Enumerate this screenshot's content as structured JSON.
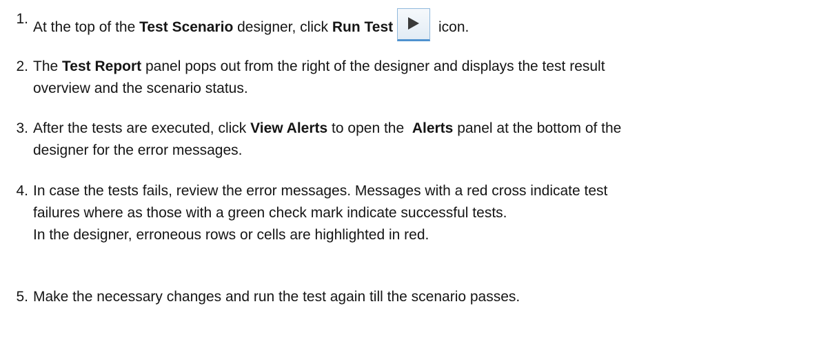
{
  "steps": [
    {
      "number": "1.",
      "parts": [
        "At the top of the ",
        "Test Scenario",
        " designer, click ",
        "Run Test",
        " icon."
      ],
      "icon": "play-icon"
    },
    {
      "number": "2.",
      "parts": [
        "The ",
        "Test Report",
        " panel pops out from the right of the designer and displays the test result"
      ],
      "line2": "overview and the scenario status."
    },
    {
      "number": "3.",
      "parts": [
        "After the tests are executed, click ",
        "View Alerts",
        " to open the  ",
        "Alerts",
        " panel at the bottom of the"
      ],
      "line2": "designer for the error messages."
    },
    {
      "number": "4.",
      "line1": "In case the tests fails, review the error messages. Messages with a red cross indicate test",
      "line2": "failures where as those with a green check mark indicate successful tests.",
      "line3": "In the designer, erroneous rows or cells are highlighted in red."
    },
    {
      "number": "5.",
      "line1": "Make the necessary changes and run the test again till the scenario passes."
    }
  ],
  "colors": {
    "text": "#151515",
    "icon_border": "#4f92cf",
    "icon_glyph": "#3a3a3a"
  }
}
